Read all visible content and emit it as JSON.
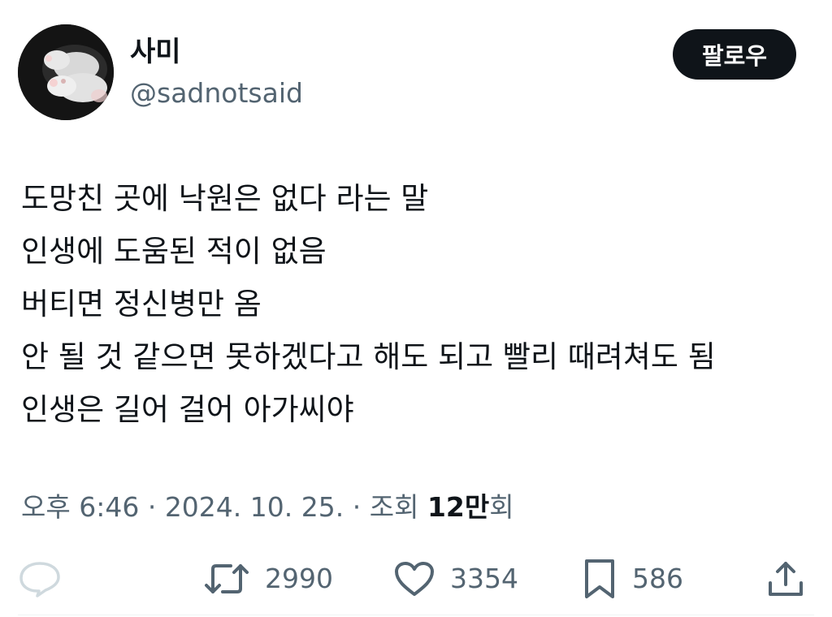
{
  "author": {
    "display_name": "사미",
    "handle": "@sadnotsaid"
  },
  "follow_button": {
    "label": "팔로우"
  },
  "tweet": {
    "lines": [
      "도망친 곳에 낙원은 없다 라는 말",
      "인생에 도움된 적이 없음",
      "버티면 정신병만 옴",
      "안 될 것 같으면 못하겠다고 해도 되고 빨리 때려쳐도 됨",
      "인생은 길어 걸어 아가씨야"
    ]
  },
  "meta": {
    "time": "오후 6:46",
    "separator": " · ",
    "date": "2024. 10. 25.",
    "views_prefix": "조회 ",
    "views_count": "12만",
    "views_suffix": "회"
  },
  "actions": {
    "reply": {
      "icon": "reply-icon",
      "count": ""
    },
    "retweet": {
      "icon": "retweet-icon",
      "count": "2990"
    },
    "like": {
      "icon": "heart-icon",
      "count": "3354"
    },
    "bookmark": {
      "icon": "bookmark-icon",
      "count": "586"
    },
    "share": {
      "icon": "share-icon"
    }
  },
  "colors": {
    "text_primary": "#0f1419",
    "text_secondary": "#536471",
    "button_bg": "#0f1419",
    "button_text": "#ffffff",
    "reply_icon": "#cfd9de",
    "divider": "#eff3f4"
  }
}
